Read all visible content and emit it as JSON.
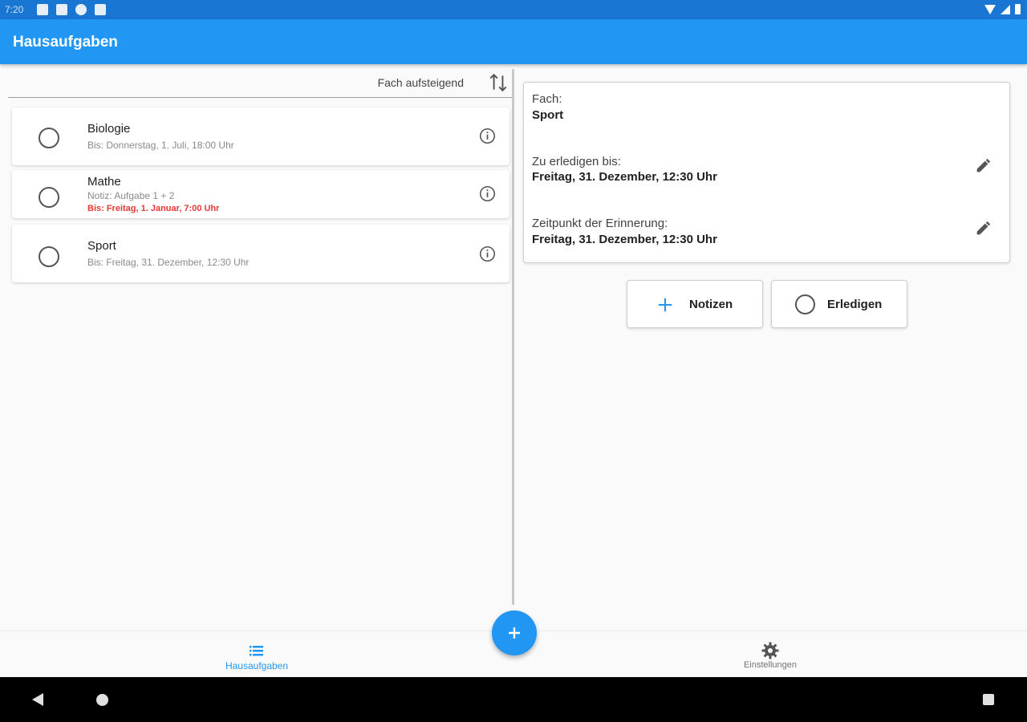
{
  "status_bar": {
    "time": "7:20"
  },
  "app_bar": {
    "title": "Hausaufgaben"
  },
  "sort": {
    "label": "Fach aufsteigend",
    "icon": "swap-vertical-icon"
  },
  "homework": [
    {
      "subject": "Biologie",
      "lines": [
        {
          "text": "Bis: Donnerstag, 1. Juli, 18:00 Uhr",
          "overdue": false
        }
      ]
    },
    {
      "subject": "Mathe",
      "lines": [
        {
          "text": "Notiz: Aufgabe 1 + 2",
          "overdue": false
        },
        {
          "text": "Bis: Freitag, 1. Januar, 7:00 Uhr",
          "overdue": true
        }
      ]
    },
    {
      "subject": "Sport",
      "lines": [
        {
          "text": "Bis: Freitag, 31. Dezember, 12:30 Uhr",
          "overdue": false
        }
      ]
    }
  ],
  "detail": {
    "subject_label": "Fach:",
    "subject_value": "Sport",
    "due_label": "Zu erledigen bis:",
    "due_value": "Freitag, 31. Dezember, 12:30 Uhr",
    "reminder_label": "Zeitpunkt der Erinnerung:",
    "reminder_value": "Freitag, 31. Dezember, 12:30 Uhr"
  },
  "actions": {
    "notes_label": "Notizen",
    "done_label": "Erledigen"
  },
  "bottom_nav": [
    {
      "label": "Hausaufgaben",
      "icon": "list-icon",
      "active": true
    },
    {
      "label": "Einstellungen",
      "icon": "gear-icon",
      "active": false
    }
  ],
  "colors": {
    "primary": "#2196f3",
    "primary_dark": "#1976d2",
    "overdue": "#e53935"
  }
}
